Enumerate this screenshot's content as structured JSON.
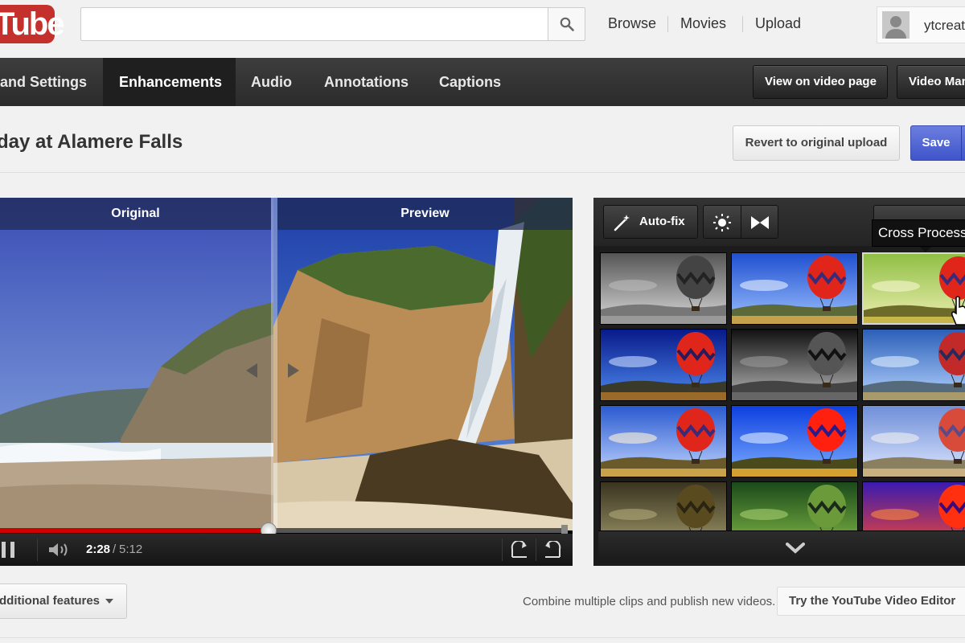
{
  "masthead": {
    "logo_text": "Tube",
    "search": {
      "value": "",
      "placeholder": ""
    },
    "nav": [
      {
        "label": "Browse"
      },
      {
        "label": "Movies"
      },
      {
        "label": "Upload"
      }
    ],
    "account_name": "ytcreat"
  },
  "editor_tabs": {
    "tabs": [
      {
        "label": "and Settings",
        "active": false
      },
      {
        "label": "Enhancements",
        "active": true
      },
      {
        "label": "Audio",
        "active": false
      },
      {
        "label": "Annotations",
        "active": false
      },
      {
        "label": "Captions",
        "active": false
      }
    ],
    "view_on_video_page_label": "View on video page",
    "video_manager_label": "Video Man"
  },
  "video": {
    "title": "day at Alamere Falls",
    "revert_label": "Revert to original upload",
    "save_label": "Save"
  },
  "player": {
    "original_label": "Original",
    "preview_label": "Preview",
    "current_time": "2:28",
    "time_separator": "/",
    "total_time": "5:12",
    "progress_fraction": 0.474
  },
  "filters": {
    "autofix_label": "Auto-fix",
    "tooltip": "Cross Process",
    "icons": [
      "magic-wand-icon",
      "brightness-icon",
      "contrast-icon",
      "chevron-down-icon",
      "rotate-left-icon",
      "rotate-right-icon"
    ],
    "thumbnails": [
      {
        "name": "black-and-white",
        "selected": false
      },
      {
        "name": "vivid",
        "selected": false
      },
      {
        "name": "cross-process",
        "selected": true
      },
      {
        "name": "deep-blue",
        "selected": false
      },
      {
        "name": "dark-mono",
        "selected": false
      },
      {
        "name": "cool",
        "selected": false
      },
      {
        "name": "warm",
        "selected": false
      },
      {
        "name": "saturated",
        "selected": false
      },
      {
        "name": "faded",
        "selected": false
      },
      {
        "name": "sepia",
        "selected": false
      },
      {
        "name": "green",
        "selected": false
      },
      {
        "name": "heat",
        "selected": false
      }
    ]
  },
  "footer": {
    "additional_features_label": "dditional features",
    "combine_text": "Combine multiple clips and publish new videos.",
    "editor_link_label": "Try the YouTube Video Editor"
  },
  "colors": {
    "brand_red": "#c4302b",
    "save_blue": "#3f55c9",
    "progress_red": "#cc0000",
    "tabbar_dark": "#2b2b2b"
  }
}
